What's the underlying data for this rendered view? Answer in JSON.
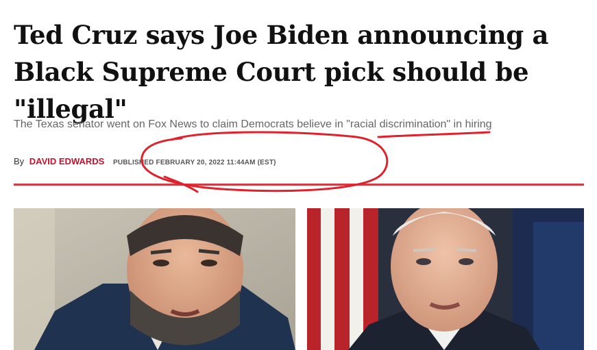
{
  "article": {
    "headline": "Ted Cruz says Joe Biden announcing a Black Supreme Court pick should be \"illegal\"",
    "subhead": "The Texas senator went on Fox News to claim Democrats believe in \"racial discrimination\" in hiring",
    "byline": {
      "prefix": "By",
      "author": "DAVID EDWARDS",
      "published": "PUBLISHED FEBRUARY 20, 2022 11:44AM (EST)"
    }
  },
  "colors": {
    "accent": "#d43a3f",
    "author": "#c8102e",
    "headline": "#111111",
    "subhead": "#666666",
    "annotation": "#e0202a"
  }
}
